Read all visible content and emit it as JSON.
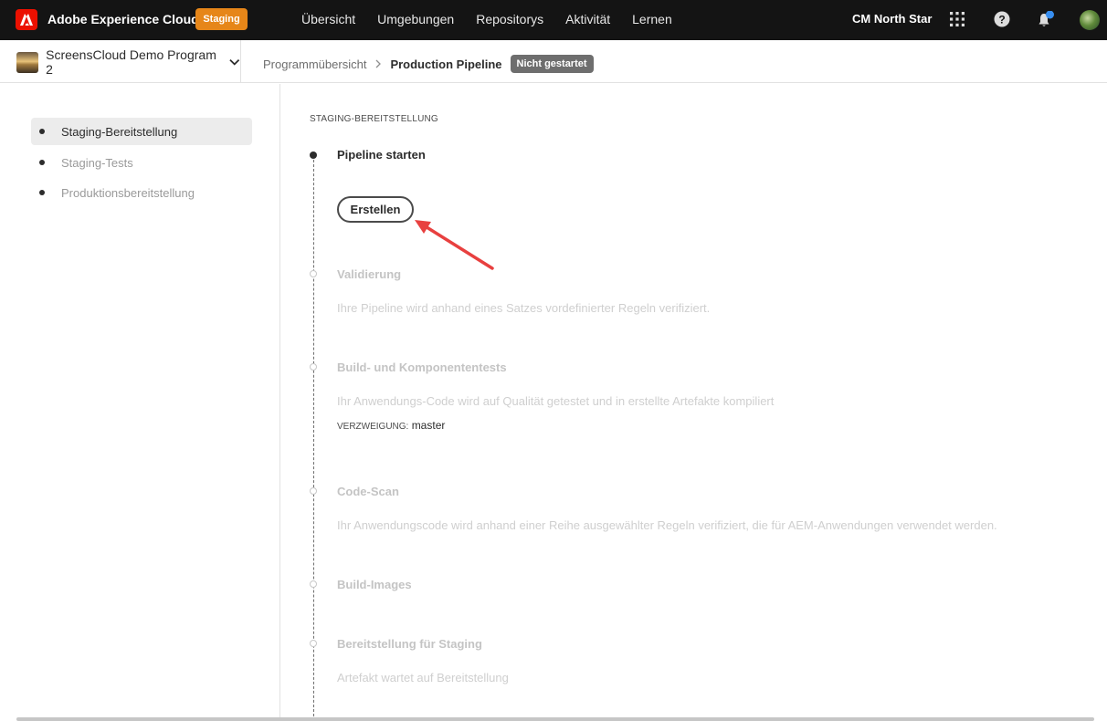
{
  "topbar": {
    "brand": "Adobe Experience Cloud",
    "env_badge": "Staging",
    "nav": [
      "Übersicht",
      "Umgebungen",
      "Repositorys",
      "Aktivität",
      "Lernen"
    ],
    "org": "CM North Star",
    "icons": [
      "apps-grid-icon",
      "help-icon",
      "bell-icon",
      "avatar"
    ],
    "colors": {
      "bar": "#141414",
      "badge": "#e68619",
      "logo": "#eb1000",
      "notif": "#378ef0"
    }
  },
  "subbar": {
    "program": "ScreensCloud Demo Program 2",
    "breadcrumb": {
      "link": "Programmübersicht",
      "current": "Production Pipeline",
      "status": "Nicht gestartet"
    }
  },
  "sidebar": {
    "items": [
      {
        "label": "Staging-Bereitstellung",
        "active": true
      },
      {
        "label": "Staging-Tests",
        "active": false
      },
      {
        "label": "Produktionsbereitstellung",
        "active": false
      }
    ]
  },
  "main": {
    "section_title": "STAGING-BEREITSTELLUNG",
    "steps": [
      {
        "title": "Pipeline starten",
        "active": true
      },
      {
        "title": "Validierung",
        "desc": "Ihre Pipeline wird anhand eines Satzes vordefinierter Regeln verifiziert."
      },
      {
        "title": "Build- und Komponententests",
        "desc": "Ihr Anwendungs-Code wird auf Qualität getestet und in erstellte Artefakte kompiliert"
      },
      {
        "title": "Code-Scan",
        "desc": "Ihr Anwendungscode wird anhand einer Reihe ausgewählter Regeln verifiziert, die für AEM-Anwendungen verwendet werden."
      },
      {
        "title": "Build-Images"
      },
      {
        "title": "Bereitstellung für Staging",
        "desc": "Artefakt wartet auf Bereitstellung"
      }
    ],
    "create_button": "Erstellen",
    "branch_label": "VERZWEIGUNG:",
    "branch_value": "master",
    "annotation_color": "#e8403f"
  }
}
